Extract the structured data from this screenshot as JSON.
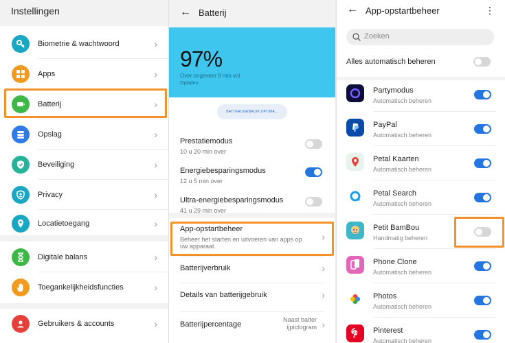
{
  "settings": {
    "title": "Instellingen",
    "items": [
      {
        "label": "Biometrie & wachtwoord",
        "icon": "key-icon",
        "color": "#1aa7c4"
      },
      {
        "label": "Apps",
        "icon": "apps-grid-icon",
        "color": "#f29a1f"
      },
      {
        "label": "Batterij",
        "icon": "battery-icon",
        "color": "#3db745"
      },
      {
        "label": "Opslag",
        "icon": "storage-icon",
        "color": "#2e7be6"
      },
      {
        "label": "Beveiliging",
        "icon": "shield-icon",
        "color": "#27b39a"
      },
      {
        "label": "Privacy",
        "icon": "privacy-icon",
        "color": "#1aa7c4"
      },
      {
        "label": "Locatietoegang",
        "icon": "location-pin-icon",
        "color": "#1aa7c4"
      },
      {
        "label": "Digitale balans",
        "icon": "hourglass-icon",
        "color": "#3db745"
      },
      {
        "label": "Toegankelijkheidsfuncties",
        "icon": "hand-icon",
        "color": "#f29a1f"
      },
      {
        "label": "Gebruikers & accounts",
        "icon": "user-icon",
        "color": "#e5413a"
      }
    ]
  },
  "battery": {
    "title": "Batterij",
    "percent": "97%",
    "remaining": "Over ongeveer 9 min vol",
    "status": "Opladen",
    "optimize_button": "BATTERIJGEBRUIK OPTIMA...",
    "modes": [
      {
        "label": "Prestatiemodus",
        "sub": "10 u 20 min over",
        "on": false
      },
      {
        "label": "Energiebesparingsmodus",
        "sub": "12 u 5 min over",
        "on": true
      },
      {
        "label": "Ultra-energiebesparingsmodus",
        "sub": "41 u 29 min over",
        "on": false
      }
    ],
    "nav": [
      {
        "label": "App-opstartbeheer",
        "sub": "Beheer het starten en uitvoeren van apps op uw apparaat."
      },
      {
        "label": "Batterijverbruik"
      },
      {
        "label": "Details van batterijgebruik"
      },
      {
        "label": "Batterijpercentage",
        "value": "Naast batter ijpictogram"
      }
    ]
  },
  "launch": {
    "title": "App-opstartbeheer",
    "search_placeholder": "Zoeken",
    "manage_all": "Alles automatisch beheren",
    "manage_all_on": false,
    "apps": [
      {
        "name": "Partymodus",
        "sub": "Automatisch beheren",
        "on": true,
        "icon": "partymode-icon"
      },
      {
        "name": "PayPal",
        "sub": "Automatisch beheren",
        "on": true,
        "icon": "paypal-icon"
      },
      {
        "name": "Petal Kaarten",
        "sub": "Automatisch beheren",
        "on": true,
        "icon": "petal-maps-icon"
      },
      {
        "name": "Petal Search",
        "sub": "Automatisch beheren",
        "on": true,
        "icon": "petal-search-icon"
      },
      {
        "name": "Petit BamBou",
        "sub": "Handmatig beheren",
        "on": false,
        "icon": "petit-bambou-icon"
      },
      {
        "name": "Phone Clone",
        "sub": "Automatisch beheren",
        "on": true,
        "icon": "phone-clone-icon"
      },
      {
        "name": "Photos",
        "sub": "Automatisch beheren",
        "on": true,
        "icon": "photos-icon"
      },
      {
        "name": "Pinterest",
        "sub": "Automatisch beheren",
        "on": true,
        "icon": "pinterest-icon"
      }
    ]
  },
  "colors": {
    "accent": "#2575e0",
    "highlight": "#f3922b",
    "battery_bg": "#3fc6ef"
  }
}
